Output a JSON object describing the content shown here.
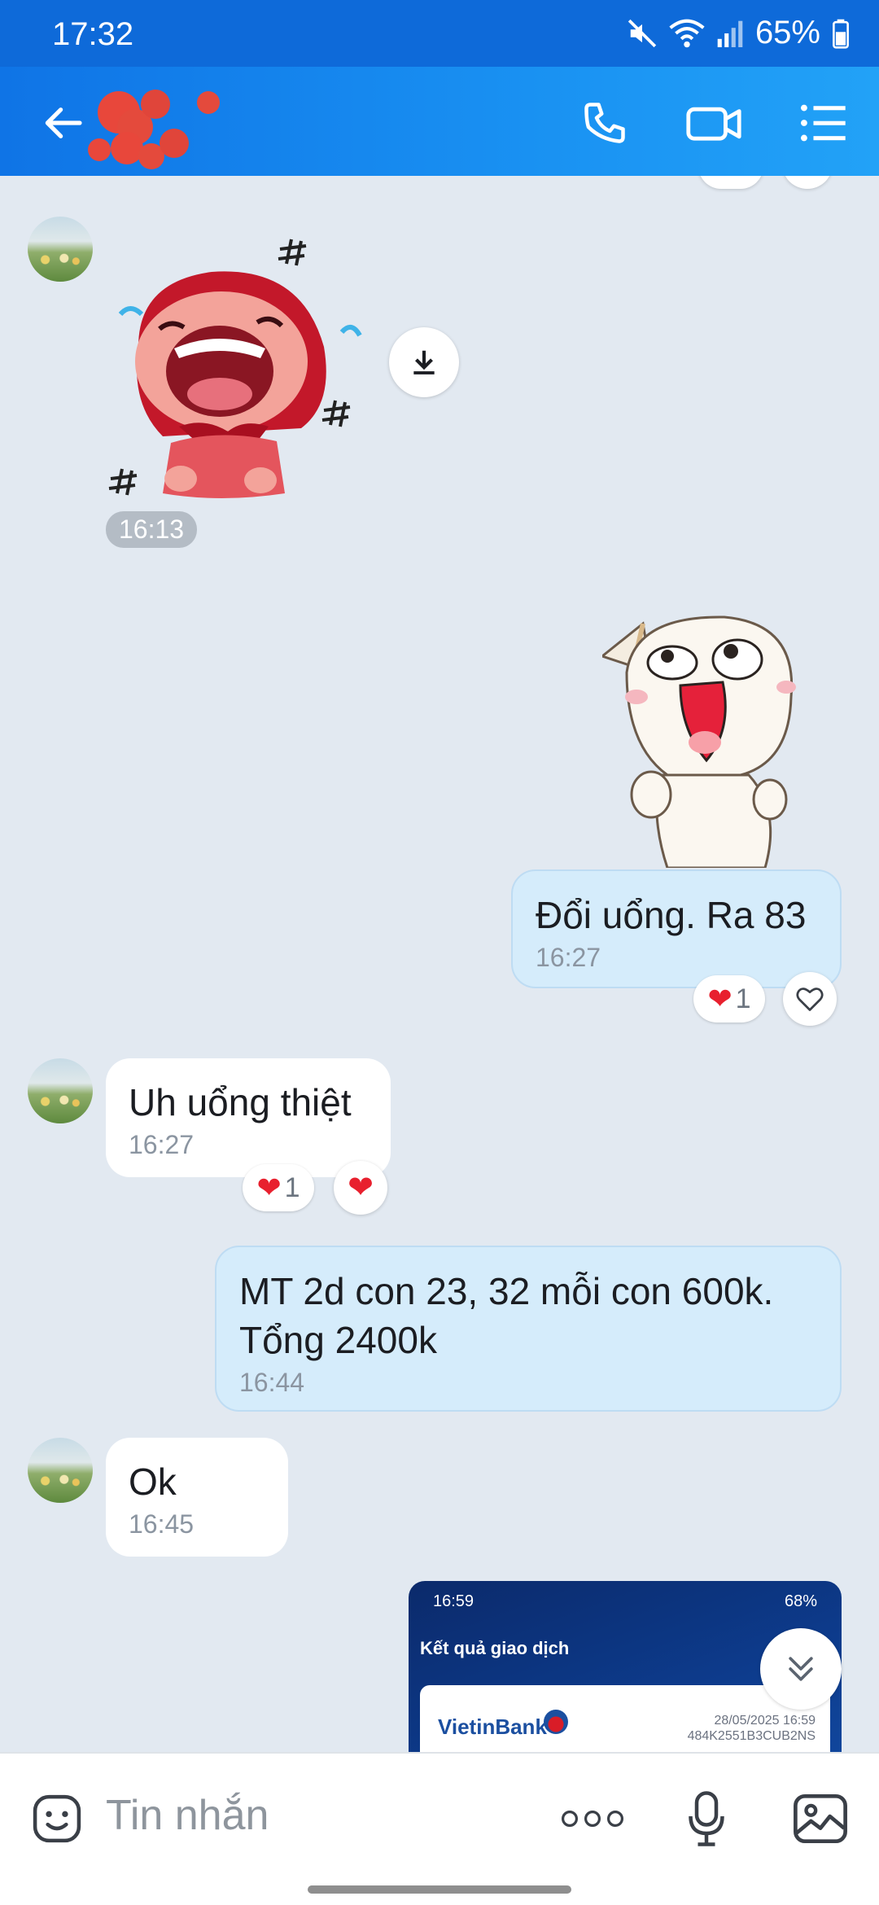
{
  "status_bar": {
    "time": "17:32",
    "battery": "65%"
  },
  "header": {
    "back_icon": "arrow-left-icon",
    "call_icon": "phone-icon",
    "video_icon": "video-camera-icon",
    "menu_icon": "list-menu-icon"
  },
  "messages": [
    {
      "side": "in",
      "type": "sticker",
      "sticker": "red-hood-girl-laughing",
      "time": "16:13"
    },
    {
      "side": "out",
      "type": "sticker",
      "sticker": "white-cat-laughing"
    },
    {
      "side": "out",
      "type": "text",
      "text": "Đổi uổng. Ra 83",
      "time": "16:27",
      "reaction_count": "1"
    },
    {
      "side": "in",
      "type": "text",
      "text": "Uh uổng thiệt",
      "time": "16:27",
      "reaction_count": "1"
    },
    {
      "side": "out",
      "type": "text",
      "text": "MT 2d con 23, 32 mỗi con 600k.\nTổng 2400k",
      "time": "16:44"
    },
    {
      "side": "in",
      "type": "text",
      "text": "Ok",
      "time": "16:45"
    },
    {
      "side": "out",
      "type": "image",
      "preview": {
        "status_time": "16:59",
        "status_battery": "68%",
        "title": "Kết quả giao dịch",
        "bank_name": "VietinBank",
        "datetime": "28/05/2025 16:59",
        "ref": "484K2551B3CUB2NS"
      }
    }
  ],
  "input": {
    "placeholder": "Tin nhắn"
  },
  "colors": {
    "header_start": "#0f74e6",
    "header_end": "#22a2f7",
    "chat_bg": "#e2e9f1",
    "out_bubble": "#d5ecfb",
    "heart": "#e8202e"
  }
}
